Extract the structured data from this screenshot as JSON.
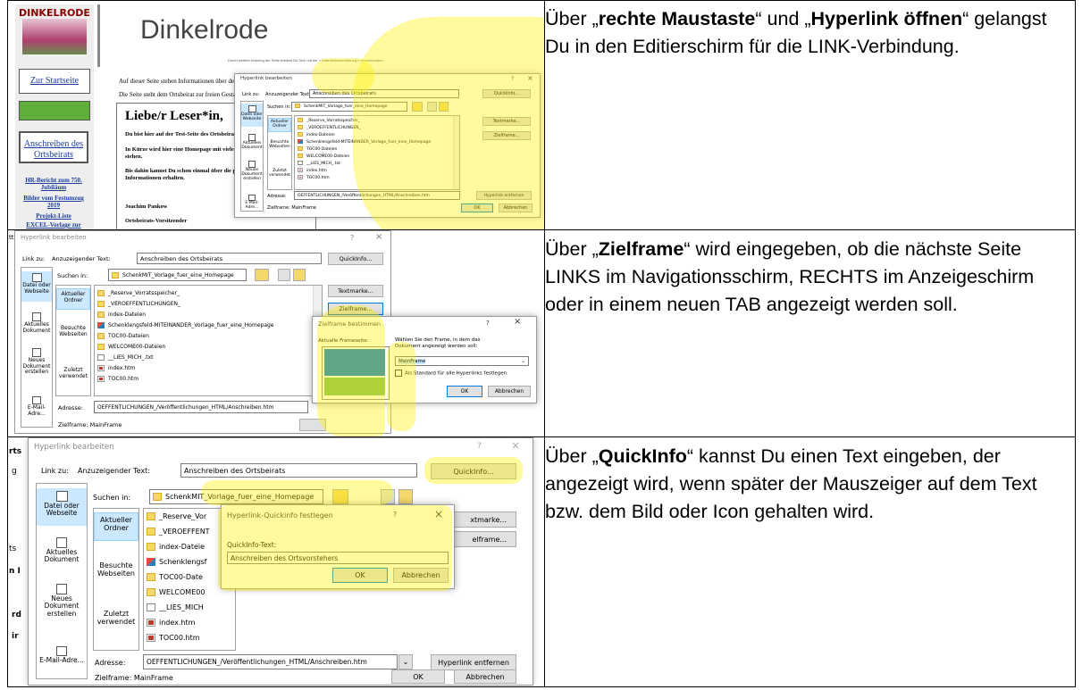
{
  "rows": [
    {
      "text_parts": [
        "Über „",
        "rechte Maustaste",
        "“ und „",
        "Hyperlink öffnen",
        "“ gelangst Du in den Editierschirm für die LINK-Verbindung."
      ]
    },
    {
      "text_parts": [
        "Über „",
        "Zielframe",
        "“ wird eingegeben, ob die nächste Seite LINKS im Navigationsschirm, RECHTS im Anzeigeschirm oder in einem neuen TAB angezeigt werden soll."
      ]
    },
    {
      "text_parts": [
        "Über „",
        "QuickInfo",
        "“ kannst Du einen Text eingeben, der angezeigt wird, wenn später der Mauszeiger auf dem Text bzw. dem Bild oder Icon gehalten wird."
      ]
    }
  ],
  "website": {
    "logo_text": "DINKELRODE",
    "title": "Dinkelrode",
    "nav": [
      "Zur Startseite",
      "Anschreiben des Ortsbeirats",
      "HR-Bericht zum 750. Jubiläum",
      "Bilder vom Festumzug 2019",
      "Projekt-Liste",
      "EXCEL-Vorlage zur Bearbeitung der"
    ],
    "notice": "Durch weitere Nutzung der Seite erklärst Du Dich mit der » Datenschutzerklärung « einverstanden.",
    "intro1": "Auf dieser Seite stehen Informationen über den Ort",
    "intro2": "Die Seite steht dem Ortsbeirat zur freien Gestaltung",
    "heading": "Liebe/r Leser*in,",
    "p1": "Du bist hier auf der Test-Seite des Ortsbeirats",
    "p2": "In Kürze wird hier eine Homepage mit vielen I",
    "p2b": "stehen.",
    "p3": "Bis dahin kannst Du schon einmal über die pr",
    "p3b": "Informationen erhalten.",
    "sig1": "Joachim Pankow",
    "sig2": "Ortsbeirats-Vorsitzender"
  },
  "dialog": {
    "title": "Hyperlink bearbeiten",
    "help": "?",
    "close": "×",
    "link_label": "Link zu:",
    "display_text_label": "Anzuzeigender Text:",
    "display_text_value": "Anschreiben des Ortsbeirats",
    "quickinfo_button": "QuickInfo...",
    "search_label": "Suchen in:",
    "search_folder": "SchenkMIT_Vorlage_fuer_eine_Homepage",
    "sidebar": [
      "Datei oder Webseite",
      "Aktuelles Dokument",
      "Neues Dokument erstellen",
      "E-Mail-Adre..."
    ],
    "sidebar_short": [
      "Datei oder Webseite",
      "Aktuelles Dokument",
      "Neues Dokument erstellen",
      "E-Mail-Adre..."
    ],
    "middle": [
      "Aktueller Ordner",
      "Besuchte Webseiten",
      "Zuletzt verwendet"
    ],
    "files": [
      "_Reserve_Vorratsspeicher_",
      "_VEROEFFENTLICHUNGEN_",
      "index-Dateien",
      "Schenklengsfeld-MITEINANDER_Vorlage_fuer_eine_Homepage",
      "TOC00-Dateien",
      "WELCOME00-Dateien",
      "__LIES_MICH_.txt",
      "index.htm",
      "TOC00.htm"
    ],
    "textmarke_button": "Textmarke...",
    "zielframe_button": "Zielframe...",
    "address_label": "Adresse:",
    "address_value": "OEFFENTLICHUNGEN_/Veröffentlichungen_HTML/Anschreiben.htm",
    "remove_button": "Hyperlink entfernen",
    "zielframe_label": "Zielframe:",
    "zielframe_value": "MainFrame",
    "ok": "OK",
    "cancel": "Abbrechen"
  },
  "zielframe_dialog": {
    "title": "Zielframe bestimmen",
    "help": "?",
    "close": "×",
    "current_label": "Aktuelle Frameseite:",
    "instruction": "Wählen Sie den Frame, in dem das Dokument angezeigt werden soll:",
    "value": "MainFrame",
    "checkbox_label": "Als Standard für alle Hyperlinks festlegen",
    "ok": "OK",
    "cancel": "Abbrechen"
  },
  "quickinfo_dialog": {
    "title": "Hyperlink-Quickinfo festlegen",
    "help": "?",
    "close": "×",
    "label": "QuickInfo-Text:",
    "value": "Anschreiben des Ortsvorstehers",
    "ok": "OK",
    "cancel": "Abbrechen"
  },
  "fragments": {
    "row2_left": "tt",
    "row3_left": [
      "rts",
      "g",
      "ts",
      "n I",
      "rd",
      "ir"
    ],
    "middle_partial": [
      "_Reserve_Vor",
      "_VEROEFFENT",
      "index-Dateie",
      "Schenklengsf",
      "TOC00-Date",
      "WELCOME00",
      "__LIES_MICH"
    ],
    "textmarke_partial": "xtmarke...",
    "zielframe_partial": "elframe..."
  },
  "colors": {
    "highlight": "#fff200",
    "frame_top": "#0078d7",
    "frame_bottom": "#7cbf5a",
    "selection": "#cce8ff"
  }
}
